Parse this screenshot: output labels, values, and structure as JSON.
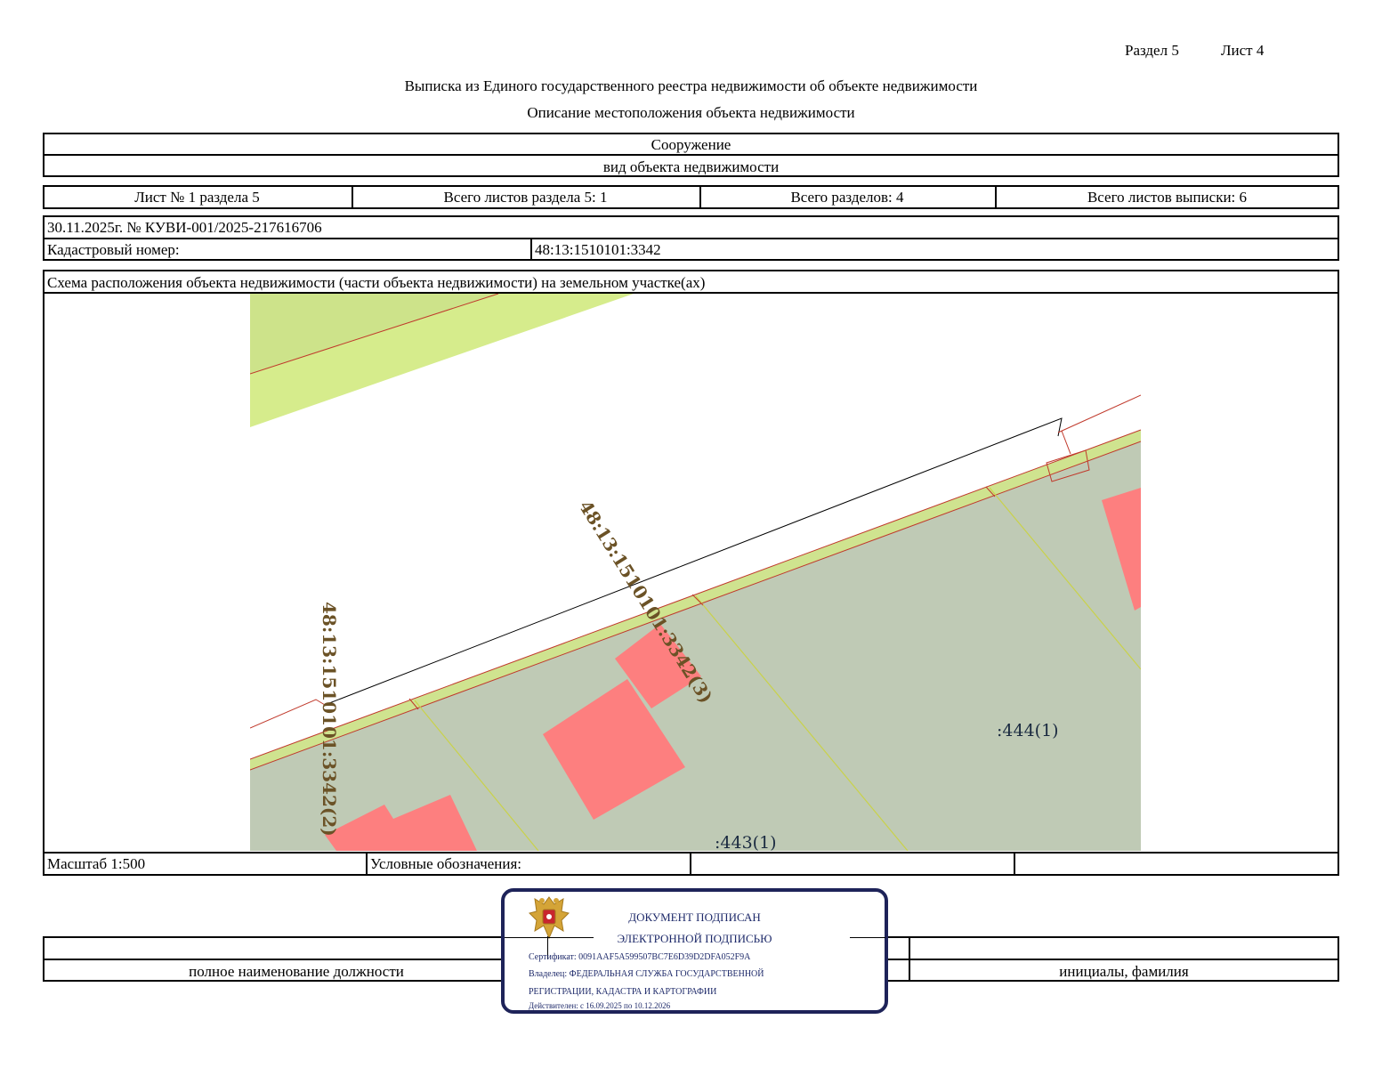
{
  "header": {
    "section_label": "Раздел 5",
    "sheet_label": "Лист 4",
    "title": "Выписка из Единого государственного реестра недвижимости об объекте недвижимости",
    "subtitle": "Описание местоположения объекта недвижимости"
  },
  "object": {
    "type": "Сооружение",
    "type_caption": "вид объекта недвижимости"
  },
  "sheets": {
    "sheet_no": "Лист № 1 раздела 5",
    "total_section_sheets": "Всего листов раздела 5: 1",
    "total_sections": "Всего разделов: 4",
    "total_extract_sheets": "Всего листов выписки: 6"
  },
  "record": {
    "date_number": "30.11.2025г. № КУВИ-001/2025-217616706",
    "cadastral_label": "Кадастровый номер:",
    "cadastral_value": "48:13:1510101:3342"
  },
  "scheme": {
    "caption": "Схема расположения объекта недвижимости (части объекта недвижимости) на земельном участке(ах)",
    "labels": {
      "part2": "48:13:1510101:3342(2)",
      "part3": "48:13:1510101:3342(3)",
      "parcel_444": ":444(1)",
      "parcel_443": ":443(1)"
    },
    "colors": {
      "parcel_fill": "#bfcab5",
      "strip_fill": "#d6ec8c",
      "building_fill": "#fd7f7f",
      "boundary_red": "#c0392b",
      "boundary_yellow": "#c9d24a",
      "label_brown": "#6b5226"
    }
  },
  "legend": {
    "scale": "Масштаб 1:500",
    "legend_label": "Условные обозначения:"
  },
  "signature": {
    "position_caption": "полное наименование должности",
    "name_caption": "инициалы, фамилия"
  },
  "stamp": {
    "line1": "ДОКУМЕНТ ПОДПИСАН",
    "line2": "ЭЛЕКТРОННОЙ ПОДПИСЬЮ",
    "certificate": "Сертификат: 0091AAF5A599507BC7E6D39D2DFA052F9A",
    "owner_line1": "Владелец: ФЕДЕРАЛЬНАЯ СЛУЖБА ГОСУДАРСТВЕННОЙ",
    "owner_line2": "РЕГИСТРАЦИИ, КАДАСТРА И КАРТОГРАФИИ",
    "valid": "Действителен: с 16.09.2025 по 10.12.2026"
  }
}
